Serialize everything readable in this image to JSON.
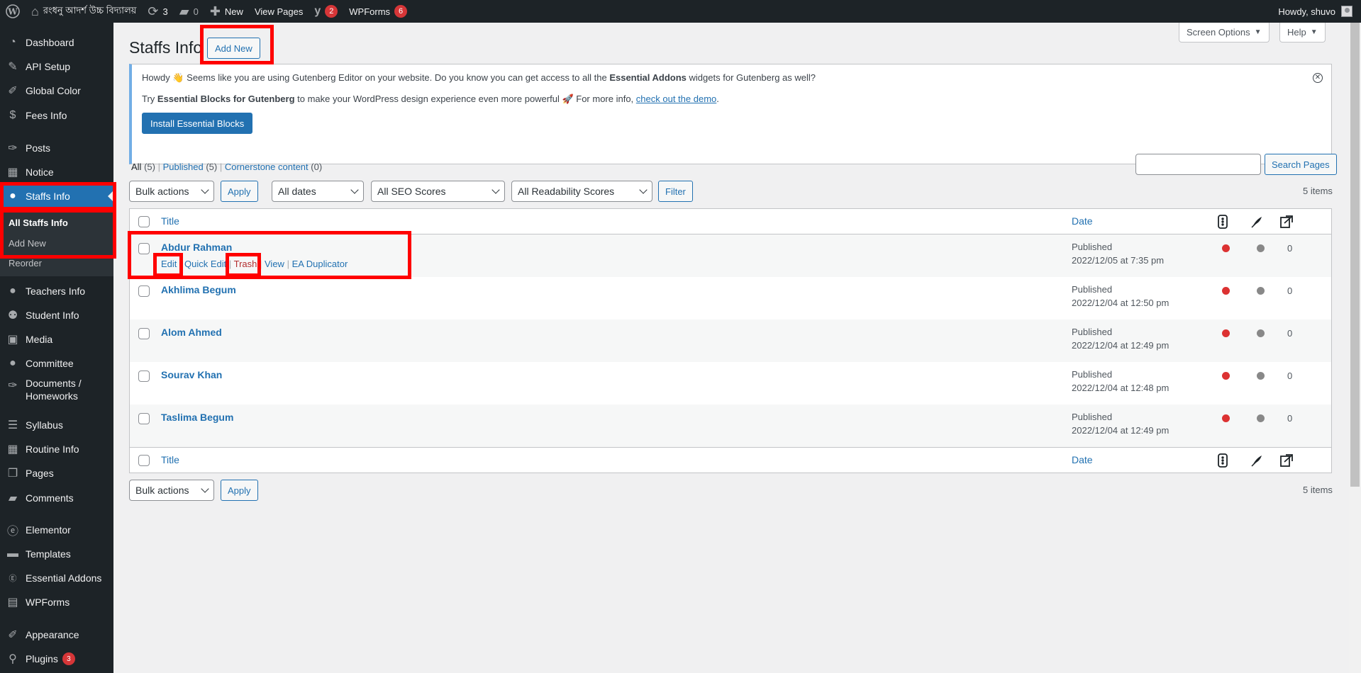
{
  "admin_bar": {
    "site_name": "রংধনু আদর্শ উচ্চ বিদ্যালয়",
    "updates_count": "3",
    "comments_count": "0",
    "new_label": "New",
    "view_pages_label": "View Pages",
    "yoast_count": "2",
    "wpforms_label": "WPForms",
    "wpforms_count": "6",
    "howdy_label": "Howdy, shuvo"
  },
  "sidebar": {
    "items": [
      {
        "label": "Dashboard",
        "icon": "dashboard-icon"
      },
      {
        "label": "API Setup",
        "icon": "wrench-icon"
      },
      {
        "label": "Global Color",
        "icon": "brush-icon"
      },
      {
        "label": "Fees Info",
        "icon": "dollar-icon"
      },
      {
        "label": "Posts",
        "icon": "pin-icon"
      },
      {
        "label": "Notice",
        "icon": "calendar-icon"
      },
      {
        "label": "Staffs Info",
        "icon": "users-icon"
      },
      {
        "label": "Teachers Info",
        "icon": "users-icon"
      },
      {
        "label": "Student Info",
        "icon": "groups-icon"
      },
      {
        "label": "Media",
        "icon": "media-icon"
      },
      {
        "label": "Committee",
        "icon": "users-icon"
      },
      {
        "label": "Documents /",
        "label2": "Homeworks",
        "icon": "pin-icon"
      },
      {
        "label": "Syllabus",
        "icon": "list-icon"
      },
      {
        "label": "Routine Info",
        "icon": "calendar-icon"
      },
      {
        "label": "Pages",
        "icon": "pages-icon"
      },
      {
        "label": "Comments",
        "icon": "comment-icon"
      },
      {
        "label": "Elementor",
        "icon": "elementor-icon"
      },
      {
        "label": "Templates",
        "icon": "folder-icon"
      },
      {
        "label": "Essential Addons",
        "icon": "ea-icon"
      },
      {
        "label": "WPForms",
        "icon": "forms-icon"
      },
      {
        "label": "Appearance",
        "icon": "brush-icon"
      },
      {
        "label": "Plugins",
        "icon": "plugin-icon",
        "badge": "3"
      }
    ],
    "submenu": {
      "all_staffs": "All Staffs Info",
      "add_new": "Add New",
      "reorder": "Reorder"
    }
  },
  "header": {
    "screen_options": "Screen Options",
    "help": "Help",
    "title": "Staffs Info",
    "add_new": "Add New"
  },
  "notice": {
    "line1_pre": "Howdy 👋 Seems like you are using Gutenberg Editor on your website. Do you know you can get access to all the ",
    "line1_bold": "Essential Addons",
    "line1_post": " widgets for Gutenberg as well?",
    "line2_pre": "Try ",
    "line2_bold": "Essential Blocks for Gutenberg",
    "line2_mid": " to make your WordPress design experience even more powerful 🚀 For more info, ",
    "line2_link": "check out the demo",
    "line2_post": ".",
    "button": "Install Essential Blocks"
  },
  "filters": {
    "views": [
      {
        "label": "All",
        "count": "(5)"
      },
      {
        "label": "Published",
        "count": "(5)"
      },
      {
        "label": "Cornerstone content",
        "count": "(0)"
      }
    ],
    "search_button": "Search Pages",
    "bulk_actions": "Bulk actions",
    "apply": "Apply",
    "dates": "All dates",
    "seo": "All SEO Scores",
    "readability": "All Readability Scores",
    "filter": "Filter",
    "items_count": "5 items"
  },
  "table": {
    "columns": {
      "title": "Title",
      "date": "Date"
    },
    "row_actions": {
      "edit": "Edit",
      "quick_edit": "Quick Edit",
      "trash": "Trash",
      "view": "View",
      "duplicate": "EA Duplicator"
    },
    "rows": [
      {
        "title": "Abdur Rahman",
        "status": "Published",
        "date": "2022/12/05 at 7:35 pm",
        "links": "0"
      },
      {
        "title": "Akhlima Begum",
        "status": "Published",
        "date": "2022/12/04 at 12:50 pm",
        "links": "0"
      },
      {
        "title": "Alom Ahmed",
        "status": "Published",
        "date": "2022/12/04 at 12:49 pm",
        "links": "0"
      },
      {
        "title": "Sourav Khan",
        "status": "Published",
        "date": "2022/12/04 at 12:48 pm",
        "links": "0"
      },
      {
        "title": "Taslima Begum",
        "status": "Published",
        "date": "2022/12/04 at 12:49 pm",
        "links": "0"
      }
    ]
  },
  "colors": {
    "admin_bar": "#1d2327",
    "accent": "#2271b1",
    "seo_dot": "#dc3232",
    "readability_dot": "#888888",
    "highlight": "#ff0000"
  }
}
